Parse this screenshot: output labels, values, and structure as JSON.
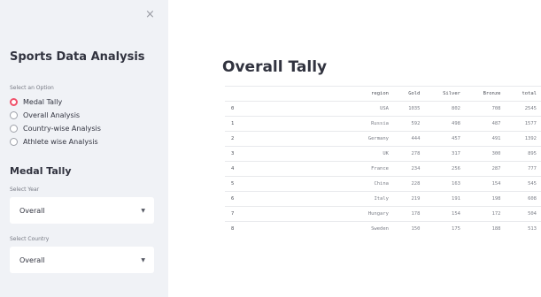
{
  "sidebar": {
    "close_icon": "×",
    "title": "Sports Data Analysis",
    "option_caption": "Select an Option",
    "options": [
      {
        "label": "Medal Tally",
        "selected": true
      },
      {
        "label": "Overall Analysis",
        "selected": false
      },
      {
        "label": "Country-wise Analysis",
        "selected": false
      },
      {
        "label": "Athlete wise Analysis",
        "selected": false
      }
    ],
    "section_title": "Medal Tally",
    "year_caption": "Select Year",
    "year_value": "Overall",
    "country_caption": "Select Country",
    "country_value": "Overall",
    "accent_color": "#f0506a"
  },
  "main": {
    "title": "Overall Tally",
    "table": {
      "columns": [
        "",
        "region",
        "Gold",
        "Silver",
        "Bronze",
        "total"
      ],
      "rows": [
        [
          "0",
          "USA",
          "1035",
          "802",
          "708",
          "2545"
        ],
        [
          "1",
          "Russia",
          "592",
          "498",
          "487",
          "1577"
        ],
        [
          "2",
          "Germany",
          "444",
          "457",
          "491",
          "1392"
        ],
        [
          "3",
          "UK",
          "278",
          "317",
          "300",
          "895"
        ],
        [
          "4",
          "France",
          "234",
          "256",
          "287",
          "777"
        ],
        [
          "5",
          "China",
          "228",
          "163",
          "154",
          "545"
        ],
        [
          "6",
          "Italy",
          "219",
          "191",
          "198",
          "608"
        ],
        [
          "7",
          "Hungary",
          "178",
          "154",
          "172",
          "504"
        ],
        [
          "8",
          "Sweden",
          "150",
          "175",
          "188",
          "513"
        ]
      ]
    }
  }
}
